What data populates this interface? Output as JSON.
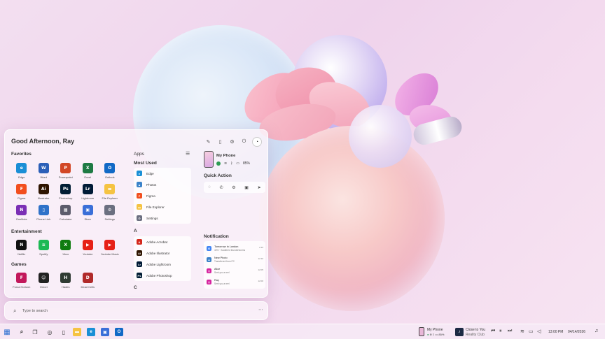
{
  "greeting": "Good Afternoon, Ray",
  "sections": {
    "favorites": "Favorites",
    "entertainment": "Entertainment",
    "games": "Games",
    "apps": "Apps",
    "most_used": "Most Used",
    "letter_a": "A",
    "letter_c": "C",
    "my_phone": "My Phone",
    "quick_action": "Quick Action",
    "notification": "Notification"
  },
  "favorites": [
    {
      "label": "Edge",
      "glyph": "e",
      "color": "#1a8fd6"
    },
    {
      "label": "Word",
      "glyph": "W",
      "color": "#2b5fb8"
    },
    {
      "label": "Powerpoint",
      "glyph": "P",
      "color": "#d24726"
    },
    {
      "label": "Excel",
      "glyph": "X",
      "color": "#1e7a44"
    },
    {
      "label": "Outlook",
      "glyph": "O",
      "color": "#1169c6"
    },
    {
      "label": "Figma",
      "glyph": "F",
      "color": "#f24e1e"
    },
    {
      "label": "Illustrator",
      "glyph": "Ai",
      "color": "#2e1400"
    },
    {
      "label": "Photoshop",
      "glyph": "Ps",
      "color": "#001d34"
    },
    {
      "label": "Lightroom",
      "glyph": "Lr",
      "color": "#001a36"
    },
    {
      "label": "File Explorer",
      "glyph": "▬",
      "color": "#f5c342"
    },
    {
      "label": "OneNote",
      "glyph": "N",
      "color": "#7b2fb5"
    },
    {
      "label": "Phone Link",
      "glyph": "▯",
      "color": "#2f72c9"
    },
    {
      "label": "Calculator",
      "glyph": "▦",
      "color": "#5b5b6b"
    },
    {
      "label": "Store",
      "glyph": "▣",
      "color": "#3a6fd8"
    },
    {
      "label": "Settings",
      "glyph": "⚙",
      "color": "#6b6f80"
    }
  ],
  "entertainment": [
    {
      "label": "Netflix",
      "glyph": "N",
      "color": "#111111"
    },
    {
      "label": "Spotify",
      "glyph": "≋",
      "color": "#1db954"
    },
    {
      "label": "Xbox",
      "glyph": "X",
      "color": "#107c10"
    },
    {
      "label": "Youtube",
      "glyph": "▶",
      "color": "#e62117"
    },
    {
      "label": "Youtube Music",
      "glyph": "▶",
      "color": "#e62117"
    }
  ],
  "games": [
    {
      "label": "Forza Horizon",
      "glyph": "F",
      "color": "#c2185b"
    },
    {
      "label": "Omori",
      "glyph": "☺",
      "color": "#222222"
    },
    {
      "label": "Hades",
      "glyph": "H",
      "color": "#2f3b33"
    },
    {
      "label": "Dead Cells",
      "glyph": "D",
      "color": "#b02a2a"
    }
  ],
  "most_used": [
    {
      "label": "Edge",
      "glyph": "e",
      "color": "#1a8fd6"
    },
    {
      "label": "Photos",
      "glyph": "▲",
      "color": "#3b82c9"
    },
    {
      "label": "Figma",
      "glyph": "F",
      "color": "#f24e1e"
    },
    {
      "label": "File Explorer",
      "glyph": "▬",
      "color": "#f5c342"
    },
    {
      "label": "Settings",
      "glyph": "⚙",
      "color": "#6b6f80"
    }
  ],
  "a_apps": [
    {
      "label": "Adobe Acrobat",
      "glyph": "A",
      "color": "#d4271c"
    },
    {
      "label": "Adobe Illustrator",
      "glyph": "Ai",
      "color": "#2e1400"
    },
    {
      "label": "Adobe Lightroom",
      "glyph": "Lr",
      "color": "#001a36"
    },
    {
      "label": "Adobe Photoshop",
      "glyph": "Ps",
      "color": "#001d34"
    }
  ],
  "phone": {
    "battery": "85%"
  },
  "notifications": [
    {
      "title": "Tomorrow in London",
      "body": "40% · Scattered thunderstorms",
      "time": "2:15",
      "glyph": "G",
      "color": "#4285f4"
    },
    {
      "title": "New Photo",
      "body": "Transferred from PC",
      "time": "12:10",
      "glyph": "▲",
      "color": "#3b82c9"
    },
    {
      "title": "Alice",
      "body": "Sent you a reel",
      "time": "12:05",
      "glyph": "◎",
      "color": "#d6249f"
    },
    {
      "title": "Ray",
      "body": "Sent you a reel",
      "time": "12:00",
      "glyph": "◎",
      "color": "#d6249f"
    }
  ],
  "search": {
    "placeholder": "Type to search"
  },
  "taskbar": {
    "phone_label": "My Phone",
    "phone_battery": "85%",
    "media_title": "Close to You",
    "media_subtitle": "Reality Club",
    "time": "13:00 PM",
    "date": "04/14/2026"
  }
}
